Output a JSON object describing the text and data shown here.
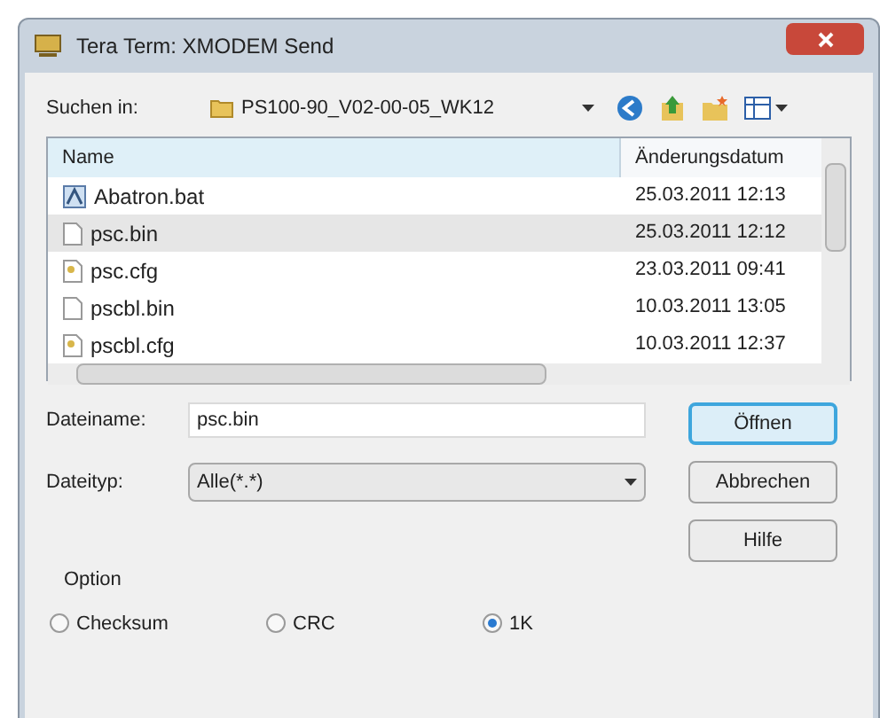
{
  "window": {
    "title": "Tera Term: XMODEM Send"
  },
  "look_in": {
    "label": "Suchen in:",
    "value": "PS100-90_V02-00-05_WK12"
  },
  "columns": [
    "Name",
    "Änderungsdatum"
  ],
  "files": [
    {
      "kind": "batch",
      "name": "Abatron.bat",
      "date": "25.03.2011 12:13",
      "selected": false
    },
    {
      "kind": "file",
      "name": "psc.bin",
      "date": "25.03.2011 12:12",
      "selected": true
    },
    {
      "kind": "config",
      "name": "psc.cfg",
      "date": "23.03.2011 09:41",
      "selected": false
    },
    {
      "kind": "file",
      "name": "pscbl.bin",
      "date": "10.03.2011 13:05",
      "selected": false
    },
    {
      "kind": "config",
      "name": "pscbl.cfg",
      "date": "10.03.2011 12:37",
      "selected": false
    }
  ],
  "filename": {
    "label": "Dateiname:",
    "value": "psc.bin"
  },
  "filetype": {
    "label": "Dateityp:",
    "value": "Alle(*.*)"
  },
  "buttons": [
    "Öffnen",
    "Abbrechen",
    "Hilfe"
  ],
  "option": {
    "label": "Option",
    "radios": [
      {
        "label": "Checksum",
        "selected": false
      },
      {
        "label": "CRC",
        "selected": false
      },
      {
        "label": "1K",
        "selected": true
      }
    ]
  }
}
